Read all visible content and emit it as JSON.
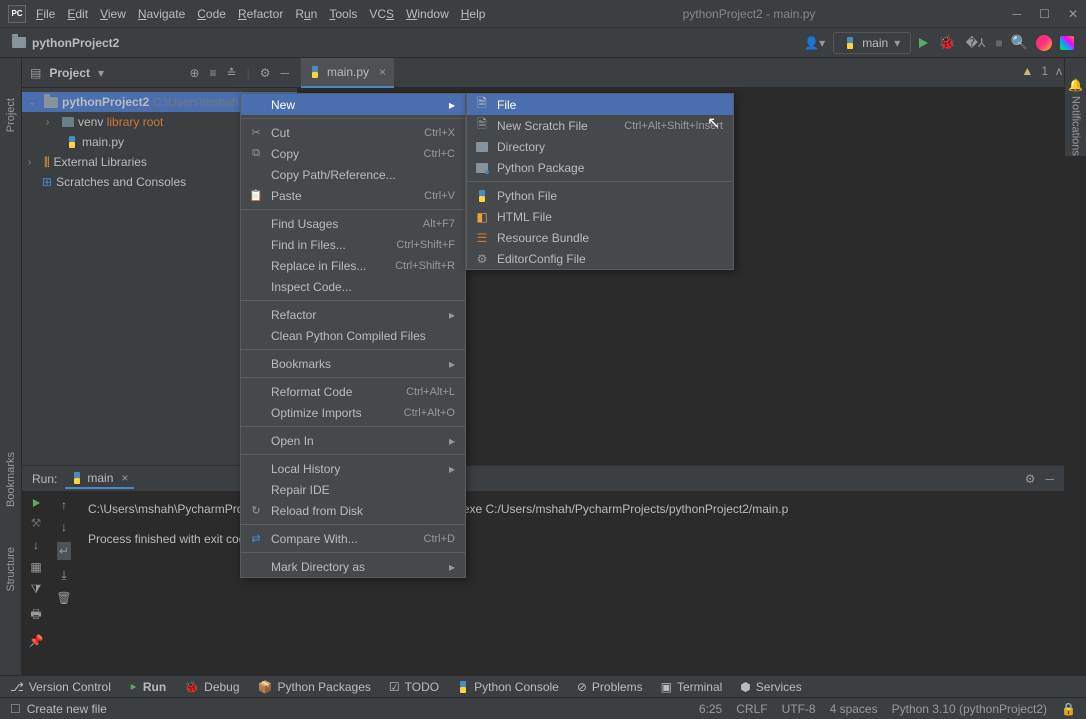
{
  "titlebar": {
    "logo": "PC",
    "title": "pythonProject2 - main.py",
    "menus": [
      "File",
      "Edit",
      "View",
      "Navigate",
      "Code",
      "Refactor",
      "Run",
      "Tools",
      "VCS",
      "Window",
      "Help"
    ]
  },
  "pathbar": {
    "project": "pythonProject2",
    "run_config": "main"
  },
  "project_panel": {
    "title": "Project",
    "root": "pythonProject2",
    "root_path": "C:\\Users\\mshah",
    "venv": "venv",
    "venv_tag": "library root",
    "main_file": "main.py",
    "ext_libs": "External Libraries",
    "scratches": "Scratches and Consoles"
  },
  "tab": {
    "name": "main.py"
  },
  "editor_status": {
    "warnings": "1"
  },
  "context_menu": {
    "new": "New",
    "cut": {
      "label": "Cut",
      "shortcut": "Ctrl+X"
    },
    "copy": {
      "label": "Copy",
      "shortcut": "Ctrl+C"
    },
    "copy_path": "Copy Path/Reference...",
    "paste": {
      "label": "Paste",
      "shortcut": "Ctrl+V"
    },
    "find_usages": {
      "label": "Find Usages",
      "shortcut": "Alt+F7"
    },
    "find_files": {
      "label": "Find in Files...",
      "shortcut": "Ctrl+Shift+F"
    },
    "replace_files": {
      "label": "Replace in Files...",
      "shortcut": "Ctrl+Shift+R"
    },
    "inspect": "Inspect Code...",
    "refactor": "Refactor",
    "clean_compiled": "Clean Python Compiled Files",
    "bookmarks": "Bookmarks",
    "reformat": {
      "label": "Reformat Code",
      "shortcut": "Ctrl+Alt+L"
    },
    "optimize": {
      "label": "Optimize Imports",
      "shortcut": "Ctrl+Alt+O"
    },
    "open_in": "Open In",
    "local_history": "Local History",
    "repair": "Repair IDE",
    "reload": "Reload from Disk",
    "compare": {
      "label": "Compare With...",
      "shortcut": "Ctrl+D"
    },
    "mark_dir": "Mark Directory as"
  },
  "submenu": {
    "file": "File",
    "scratch": {
      "label": "New Scratch File",
      "shortcut": "Ctrl+Alt+Shift+Insert"
    },
    "directory": "Directory",
    "python_pkg": "Python Package",
    "python_file": "Python File",
    "html_file": "HTML File",
    "resource_bundle": "Resource Bundle",
    "editorconfig": "EditorConfig File"
  },
  "run_panel": {
    "title": "Run:",
    "config": "main",
    "console_line1": "C:\\Users\\mshah\\PycharmProjects\\pythonProject2\\venv\\Scripts\\python.exe C:/Users/mshah/PycharmProjects/pythonProject2/main.p",
    "console_line2": "Process finished with exit code 0"
  },
  "footer": {
    "version_control": "Version Control",
    "run": "Run",
    "debug": "Debug",
    "packages": "Python Packages",
    "todo": "TODO",
    "console": "Python Console",
    "problems": "Problems",
    "terminal": "Terminal",
    "services": "Services"
  },
  "status": {
    "hint": "Create new file",
    "pos": "6:25",
    "line_ending": "CRLF",
    "encoding": "UTF-8",
    "indent": "4 spaces",
    "interpreter": "Python 3.10 (pythonProject2)"
  },
  "sidebars": {
    "project": "Project",
    "bookmarks": "Bookmarks",
    "structure": "Structure",
    "notifications": "Notifications"
  }
}
